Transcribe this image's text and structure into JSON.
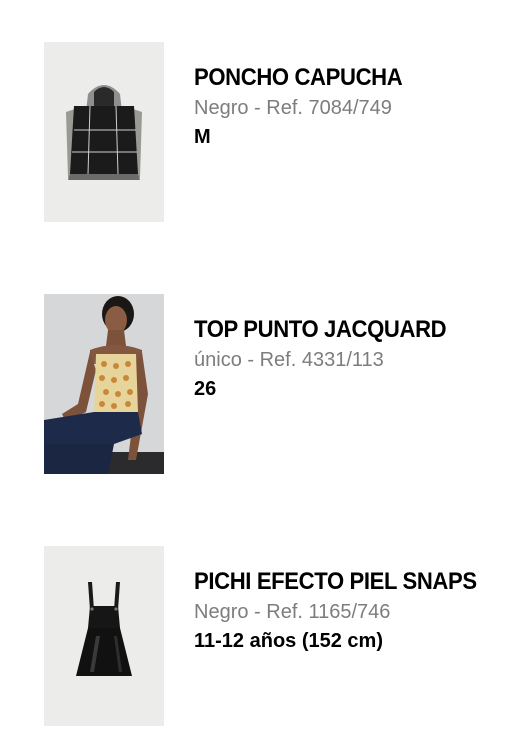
{
  "items": [
    {
      "name": "PONCHO CAPUCHA",
      "variant": "Negro - Ref. 7084/749",
      "size": "M",
      "image_icon": "poncho-product-image"
    },
    {
      "name": "TOP PUNTO JACQUARD",
      "variant": "único - Ref. 4331/113",
      "size": "26",
      "image_icon": "model-wearing-top-image"
    },
    {
      "name": "PICHI EFECTO PIEL SNAPS",
      "variant": "Negro - Ref. 1165/746",
      "size": "11-12 años (152 cm)",
      "image_icon": "pinafore-dress-image"
    }
  ],
  "colors": {
    "background": "#ffffff",
    "thumb_background": "#ececeb",
    "secondary_text": "#7d7d7d"
  }
}
